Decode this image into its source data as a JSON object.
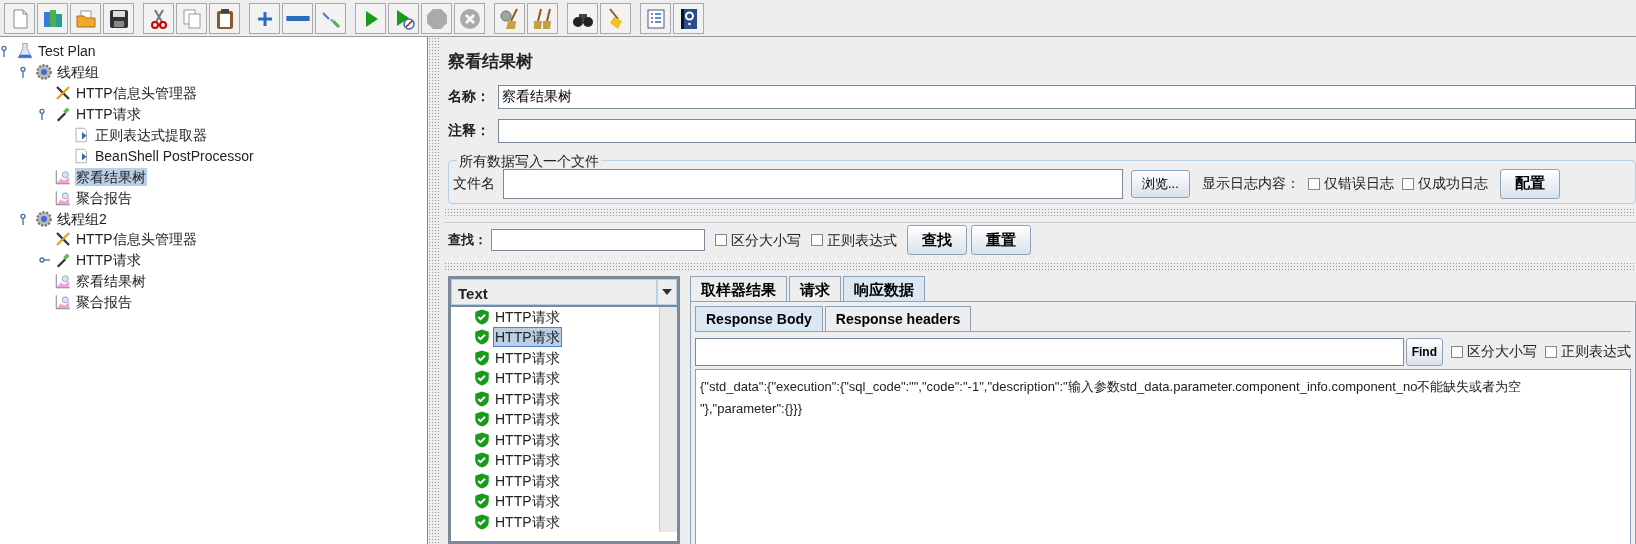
{
  "toolbar": [
    {
      "buttons": [
        {
          "kind": "new",
          "disabled": false
        },
        {
          "kind": "templates",
          "disabled": false
        },
        {
          "kind": "open",
          "disabled": false
        },
        {
          "kind": "save",
          "disabled": false
        }
      ]
    },
    {
      "buttons": [
        {
          "kind": "cut",
          "disabled": false
        },
        {
          "kind": "copy",
          "disabled": false
        },
        {
          "kind": "paste",
          "disabled": false
        }
      ]
    },
    {
      "buttons": [
        {
          "kind": "expand",
          "disabled": false
        },
        {
          "kind": "collapse",
          "disabled": false
        },
        {
          "kind": "toggle",
          "disabled": false
        }
      ]
    },
    {
      "buttons": [
        {
          "kind": "start",
          "disabled": false
        },
        {
          "kind": "start_no_pause",
          "disabled": false
        },
        {
          "kind": "stop",
          "disabled": true
        },
        {
          "kind": "shutdown",
          "disabled": true
        }
      ]
    },
    {
      "buttons": [
        {
          "kind": "clear",
          "disabled": false
        },
        {
          "kind": "clear_all",
          "disabled": false
        }
      ]
    },
    {
      "buttons": [
        {
          "kind": "search",
          "disabled": false
        },
        {
          "kind": "reset_search",
          "disabled": false
        }
      ]
    },
    {
      "buttons": [
        {
          "kind": "function_helper",
          "disabled": false
        },
        {
          "kind": "help",
          "disabled": false
        }
      ]
    }
  ],
  "tree": [
    {
      "label": "Test Plan",
      "kind": "plan",
      "selected": false,
      "expanded": true,
      "children": [
        {
          "label": "线程组",
          "kind": "threadgroup",
          "selected": false,
          "expanded": true,
          "children": [
            {
              "label": "HTTP信息头管理器",
              "kind": "config",
              "selected": false
            },
            {
              "label": "HTTP请求",
              "kind": "sampler",
              "selected": false,
              "expanded": true,
              "children": [
                {
                  "label": "正则表达式提取器",
                  "kind": "postprocessor",
                  "selected": false
                },
                {
                  "label": "BeanShell PostProcessor",
                  "kind": "postprocessor",
                  "selected": false
                }
              ]
            },
            {
              "label": "察看结果树",
              "kind": "listener",
              "selected": true
            },
            {
              "label": "聚合报告",
              "kind": "listener",
              "selected": false
            }
          ]
        },
        {
          "label": "线程组2",
          "kind": "threadgroup",
          "selected": false,
          "expanded": true,
          "children": [
            {
              "label": "HTTP信息头管理器",
              "kind": "config",
              "selected": false
            },
            {
              "label": "HTTP请求",
              "kind": "sampler",
              "selected": false,
              "expanded": false
            },
            {
              "label": "察看结果树",
              "kind": "listener",
              "selected": false
            },
            {
              "label": "聚合报告",
              "kind": "listener",
              "selected": false
            }
          ]
        }
      ]
    }
  ],
  "panel": {
    "title": "察看结果树",
    "name_label": "名称：",
    "name_value": "察看结果树",
    "comment_label": "注释：",
    "file_group": {
      "legend": "所有数据写入一个文件",
      "file_label": "文件名",
      "browse_button": "浏览...",
      "log_label": "显示日志内容：",
      "checkboxes": [
        {
          "label": "仅错误日志",
          "checked": false
        },
        {
          "label": "仅成功日志",
          "checked": false
        }
      ],
      "config_button": "配置"
    }
  },
  "search": {
    "label": "查找：",
    "checkboxes": [
      {
        "label": "区分大小写",
        "checked": false
      },
      {
        "label": "正则表达式",
        "checked": false
      }
    ],
    "buttons": [
      "查找",
      "重置"
    ]
  },
  "results": {
    "column": "Text",
    "items": [
      {
        "label": "HTTP请求",
        "success": true,
        "selected": false
      },
      {
        "label": "HTTP请求",
        "success": true,
        "selected": true
      },
      {
        "label": "HTTP请求",
        "success": true,
        "selected": false
      },
      {
        "label": "HTTP请求",
        "success": true,
        "selected": false
      },
      {
        "label": "HTTP请求",
        "success": true,
        "selected": false
      },
      {
        "label": "HTTP请求",
        "success": true,
        "selected": false
      },
      {
        "label": "HTTP请求",
        "success": true,
        "selected": false
      },
      {
        "label": "HTTP请求",
        "success": true,
        "selected": false
      },
      {
        "label": "HTTP请求",
        "success": true,
        "selected": false
      },
      {
        "label": "HTTP请求",
        "success": true,
        "selected": false
      },
      {
        "label": "HTTP请求",
        "success": true,
        "selected": false
      }
    ]
  },
  "tabs": [
    {
      "label": "取样器结果",
      "selected": false
    },
    {
      "label": "请求",
      "selected": false
    },
    {
      "label": "响应数据",
      "selected": true
    }
  ],
  "subtabs": [
    {
      "label": "Response Body",
      "selected": true
    },
    {
      "label": "Response headers",
      "selected": false
    }
  ],
  "response": {
    "find_button": "Find",
    "checkboxes": [
      {
        "label": "区分大小写",
        "checked": false
      },
      {
        "label": "正则表达式",
        "checked": false
      }
    ],
    "lines": [
      "{\"std_data\":{\"execution\":{\"sql_code\":\"\",\"code\":\"-1\",\"description\":\"输入参数std_data.parameter.component_info.component_no不能缺失或者为空",
      "\"},\"parameter\":{}}}"
    ]
  }
}
